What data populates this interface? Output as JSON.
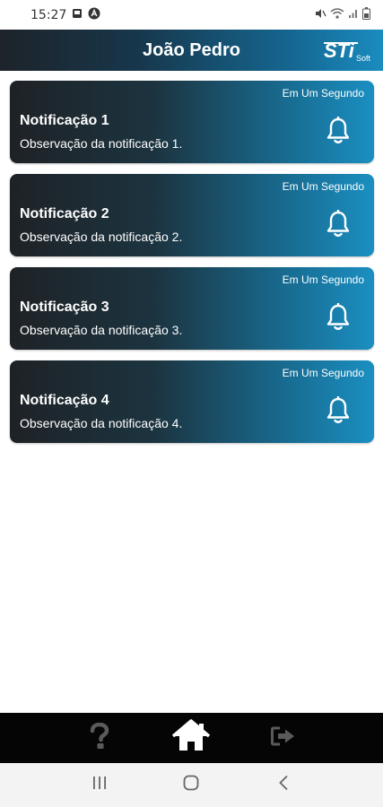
{
  "status_bar": {
    "time": "15:27",
    "icons": [
      "gallery-icon",
      "a-badge-icon",
      "mute-icon",
      "wifi-icon",
      "signal-icon",
      "battery-icon"
    ]
  },
  "header": {
    "title": "João Pedro",
    "logo_main": "STi",
    "logo_sub": "Soft"
  },
  "notifications": [
    {
      "title": "Notificação 1",
      "description": "Observação da notificação 1.",
      "time": "Em Um Segundo",
      "icon": "bell-icon"
    },
    {
      "title": "Notificação 2",
      "description": "Observação da notificação 2.",
      "time": "Em Um Segundo",
      "icon": "bell-icon"
    },
    {
      "title": "Notificação 3",
      "description": "Observação da notificação 3.",
      "time": "Em Um Segundo",
      "icon": "bell-icon"
    },
    {
      "title": "Notificação 4",
      "description": "Observação da notificação 4.",
      "time": "Em Um Segundo",
      "icon": "bell-icon"
    }
  ],
  "bottom_nav": {
    "items": [
      {
        "icon": "help-icon",
        "active": false
      },
      {
        "icon": "home-icon",
        "active": true
      },
      {
        "icon": "logout-icon",
        "active": false
      }
    ]
  },
  "system_nav": {
    "items": [
      "recents-icon",
      "home-circle-icon",
      "back-icon"
    ]
  },
  "colors": {
    "header_gradient_start": "#1d2329",
    "header_gradient_end": "#1a8cbf",
    "card_gradient_start": "#1e2226",
    "card_gradient_end": "#1a8fc1",
    "bottom_nav_bg": "#050505",
    "nav_inactive": "#5a5a5a",
    "nav_active": "#ffffff"
  }
}
